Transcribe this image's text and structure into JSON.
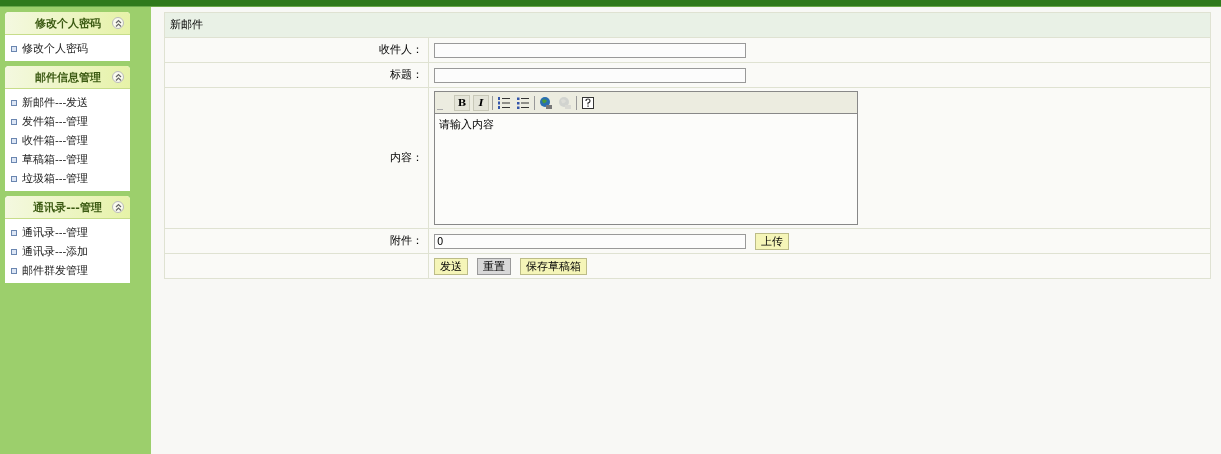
{
  "sidebar": {
    "panels": [
      {
        "title": "修改个人密码",
        "expanded": true,
        "items": [
          "修改个人密码"
        ]
      },
      {
        "title": "邮件信息管理",
        "expanded": true,
        "items": [
          "新邮件---发送",
          "发件箱---管理",
          "收件箱---管理",
          "草稿箱---管理",
          "垃圾箱---管理"
        ]
      },
      {
        "title": "通讯录---管理",
        "expanded": true,
        "items": [
          "通讯录---管理",
          "通讯录---添加",
          "邮件群发管理"
        ]
      }
    ]
  },
  "form": {
    "title": "新邮件",
    "fields": [
      {
        "kind": "text",
        "label": "收件人："
      },
      {
        "kind": "text",
        "label": "标题："
      },
      {
        "kind": "editor",
        "label": "内容：",
        "value": "请输入内容",
        "toolbar": [
          {
            "kind": "bold",
            "label": "B",
            "disabled": false
          },
          {
            "kind": "italic",
            "label": "I",
            "disabled": false
          },
          {
            "kind": "separator"
          },
          {
            "kind": "ordered-list",
            "disabled": false
          },
          {
            "kind": "unordered-list",
            "disabled": false
          },
          {
            "kind": "separator"
          },
          {
            "kind": "link",
            "disabled": false
          },
          {
            "kind": "unlink",
            "disabled": true
          },
          {
            "kind": "separator"
          },
          {
            "kind": "help",
            "disabled": false
          }
        ]
      },
      {
        "kind": "file",
        "label": "附件：",
        "value": "0",
        "button": "上传"
      },
      {
        "kind": "actions",
        "buttons": [
          {
            "label": "发送",
            "kind": "primary"
          },
          {
            "label": "重置",
            "kind": "reset"
          },
          {
            "label": "保存草稿箱",
            "kind": "primary"
          }
        ]
      }
    ]
  }
}
